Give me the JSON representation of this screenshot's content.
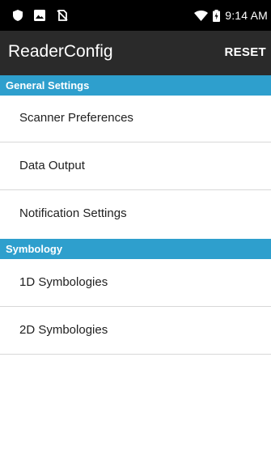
{
  "status_bar": {
    "time": "9:14 AM",
    "left_icons": [
      "shield-icon",
      "image-icon",
      "no-sim-icon"
    ],
    "right_icons": [
      "wifi-icon",
      "battery-charging-icon"
    ]
  },
  "app_bar": {
    "title": "ReaderConfig",
    "action_label": "RESET"
  },
  "sections": [
    {
      "title": "General Settings",
      "items": [
        {
          "label": "Scanner Preferences"
        },
        {
          "label": "Data Output"
        },
        {
          "label": "Notification Settings"
        }
      ]
    },
    {
      "title": "Symbology",
      "items": [
        {
          "label": "1D Symbologies"
        },
        {
          "label": "2D Symbologies"
        }
      ]
    }
  ],
  "colors": {
    "status_bar": "#000000",
    "app_bar": "#2a2a2a",
    "section_header": "#2e9fcd",
    "divider": "#d8d8d8",
    "text": "#212121"
  }
}
